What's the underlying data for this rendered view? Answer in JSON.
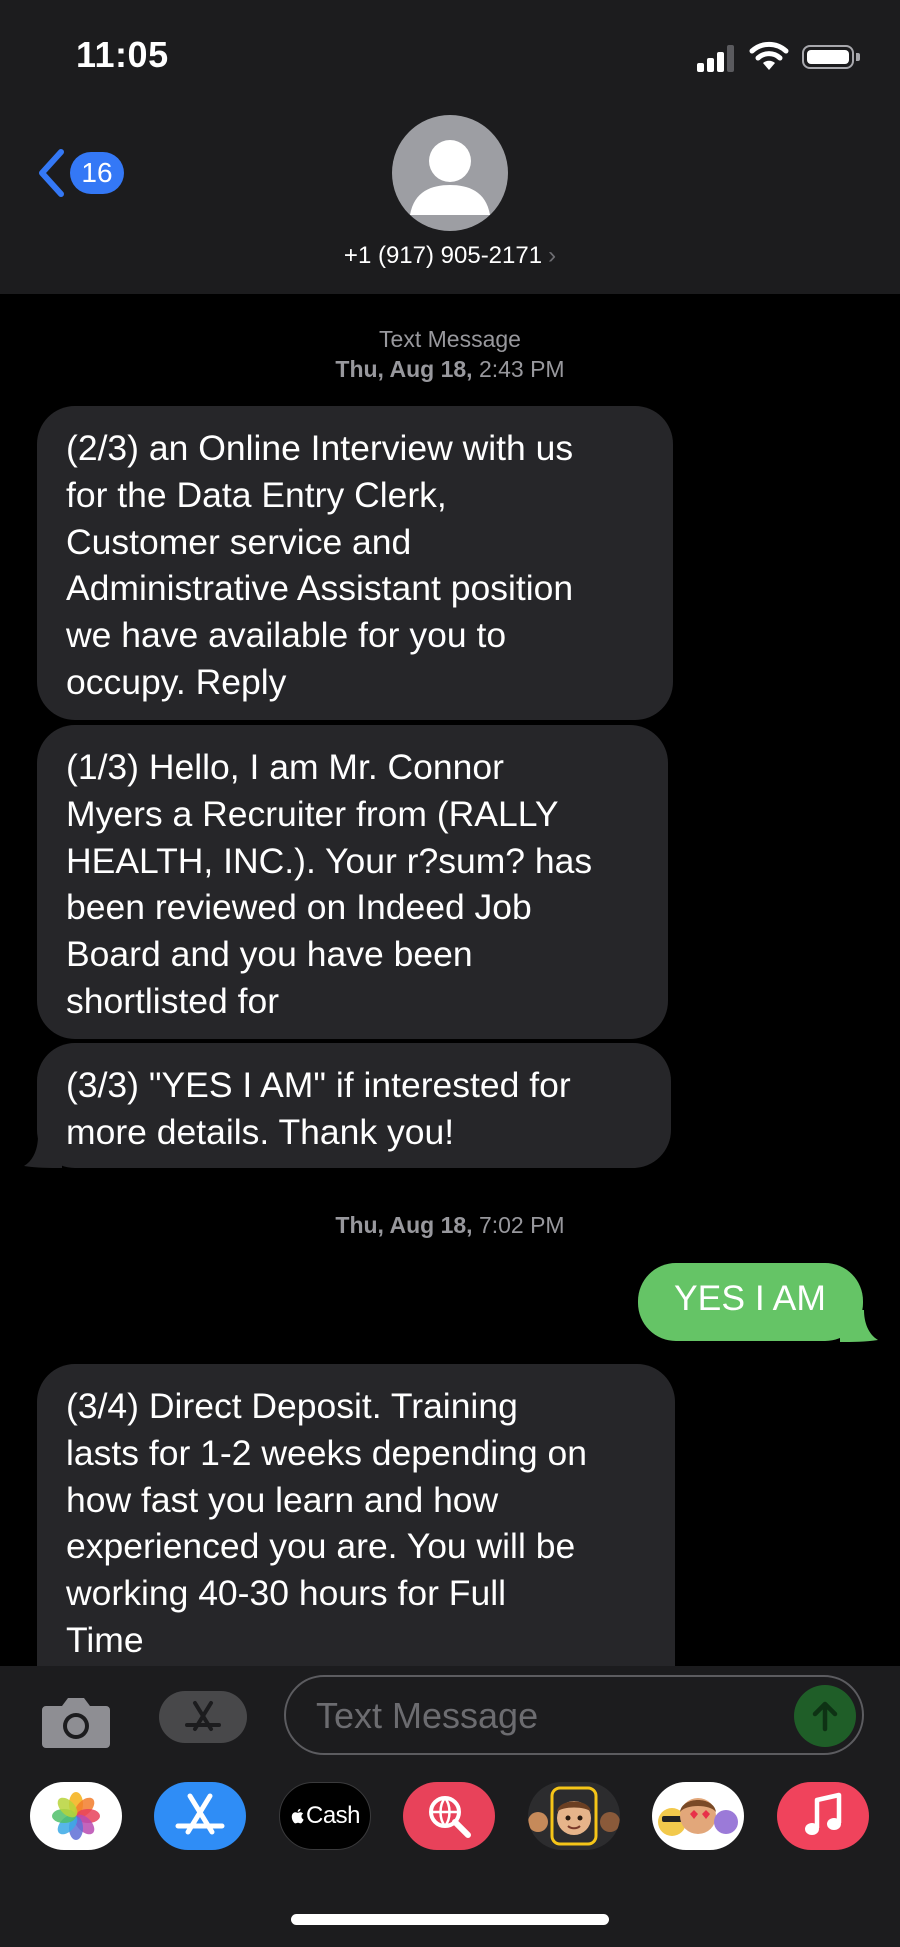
{
  "status_bar": {
    "time": "11:05"
  },
  "nav": {
    "back_count": "16",
    "contact": "+1 (917) 905-2171",
    "chevron": "›"
  },
  "thread": {
    "ts1_service": "Text Message",
    "ts1_date": "Thu, Aug 18,",
    "ts1_time": "2:43 PM",
    "ts2_date": "Thu, Aug 18,",
    "ts2_time": "7:02 PM",
    "messages": [
      {
        "direction": "received",
        "text": "(2/3) an Online Interview with us\nfor the Data Entry Clerk,\nCustomer service and\nAdministrative Assistant position\nwe have available for you to\noccupy. Reply"
      },
      {
        "direction": "received",
        "text": "(1/3) Hello, I am Mr. Connor\nMyers a Recruiter from (RALLY\nHEALTH, INC.). Your r?sum? has\nbeen reviewed on Indeed Job\nBoard and you have been\nshortlisted for"
      },
      {
        "direction": "received",
        "text": "(3/3) \"YES I AM\" if interested for\nmore details. Thank you!"
      },
      {
        "direction": "sent",
        "text": "YES I AM"
      },
      {
        "direction": "received",
        "text": "(3/4) Direct Deposit. Training\nlasts for 1-2 weeks depending on\nhow fast you learn and how\nexperienced you are. You will be\nworking 40-30 hours for Full\nTime"
      }
    ]
  },
  "compose": {
    "placeholder": "Text Message"
  },
  "app_drawer": {
    "apps": [
      {
        "icon": "photos-icon"
      },
      {
        "icon": "app-store-icon"
      },
      {
        "icon": "apple-cash-icon",
        "label": "Cash"
      },
      {
        "icon": "web-search-icon"
      },
      {
        "icon": "memoji-icon"
      },
      {
        "icon": "memoji-stickers-icon"
      },
      {
        "icon": "music-icon"
      }
    ]
  },
  "colors": {
    "header_bg": "#1c1c1e",
    "received_bubble": "#262629",
    "sent_bubble": "#65c466",
    "back_badge": "#3478f6",
    "send_button": "#1f5e28"
  }
}
